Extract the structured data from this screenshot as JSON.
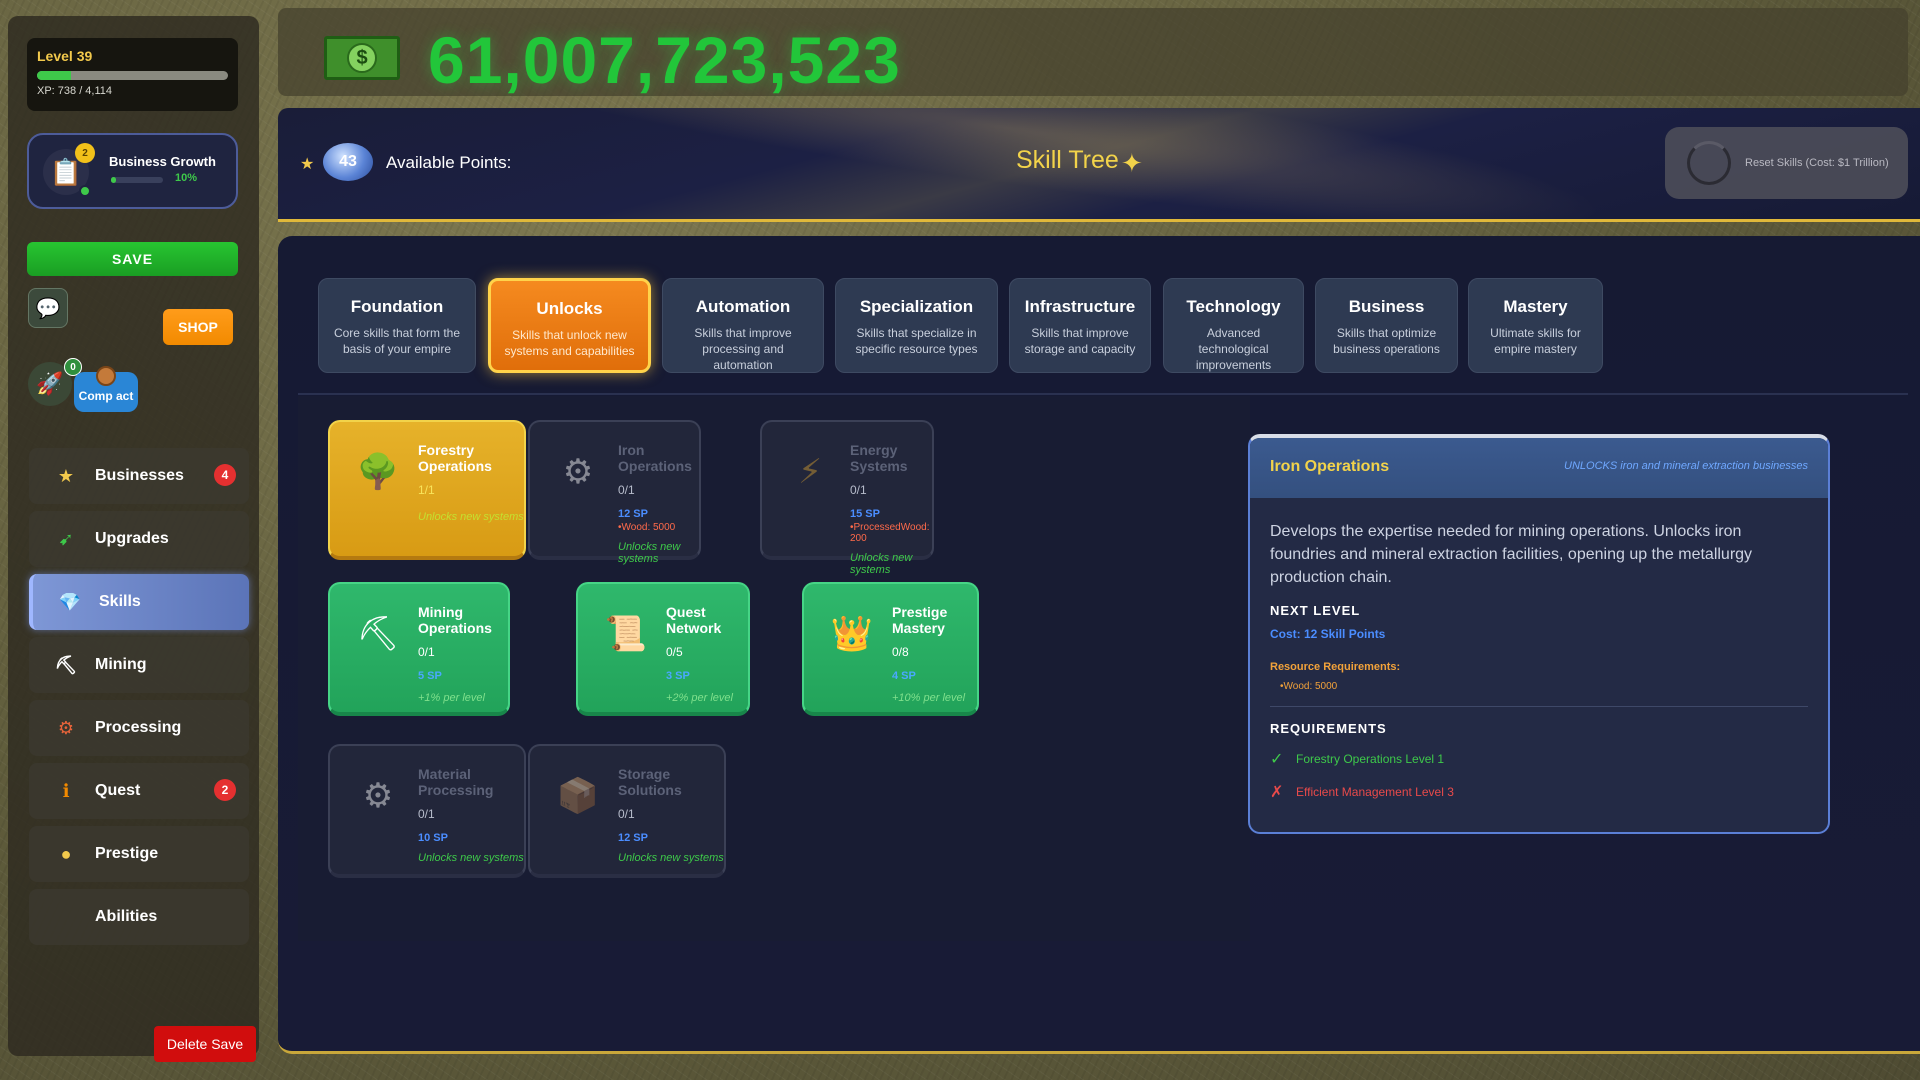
{
  "player": {
    "level_label": "Level 39",
    "xp_text": "XP: 738 / 4,114",
    "xp_fraction": 0.179
  },
  "growth": {
    "label": "Business Growth",
    "percent_text": "10%",
    "fraction": 0.1,
    "badge": "2"
  },
  "buttons": {
    "save": "SAVE",
    "shop": "SHOP",
    "compact": "Comp act",
    "rocket_badge": "0",
    "delete_save": "Delete Save"
  },
  "nav": {
    "items": [
      {
        "label": "Businesses",
        "icon": "star-icon",
        "glyph": "★",
        "badge": "4",
        "active": false
      },
      {
        "label": "Upgrades",
        "icon": "upgrade-arrow-icon",
        "glyph": "➹",
        "badge": "",
        "active": false
      },
      {
        "label": "Skills",
        "icon": "diamond-icon",
        "glyph": "💎",
        "badge": "",
        "active": true
      },
      {
        "label": "Mining",
        "icon": "mining-cart-icon",
        "glyph": "⛏",
        "badge": "",
        "active": false
      },
      {
        "label": "Processing",
        "icon": "gear-icon",
        "glyph": "⚙",
        "badge": "",
        "active": false
      },
      {
        "label": "Quest",
        "icon": "info-icon",
        "glyph": "ℹ",
        "badge": "2",
        "active": false
      },
      {
        "label": "Prestige",
        "icon": "coin-icon",
        "glyph": "●",
        "badge": "",
        "active": false
      },
      {
        "label": "Abilities",
        "icon": "",
        "glyph": "",
        "badge": "",
        "active": false
      }
    ]
  },
  "money": {
    "amount": "61,007,723,523",
    "icon": "dollar-bill-icon"
  },
  "skill_tree": {
    "available_points_value": "43",
    "available_points_label": "Available Points:",
    "title": "Skill Tree",
    "reset_label": "Reset Skills (Cost: $1 Trillion)"
  },
  "tabs": [
    {
      "title": "Foundation",
      "desc": "Core skills that form the basis of your empire",
      "active": false
    },
    {
      "title": "Unlocks",
      "desc": "Skills that unlock new systems and capabilities",
      "active": true
    },
    {
      "title": "Automation",
      "desc": "Skills that improve processing and automation",
      "active": false
    },
    {
      "title": "Specialization",
      "desc": "Skills that specialize in specific resource types",
      "active": false
    },
    {
      "title": "Infrastructure",
      "desc": "Skills that improve storage and capacity",
      "active": false
    },
    {
      "title": "Technology",
      "desc": "Advanced technological improvements",
      "active": false
    },
    {
      "title": "Business",
      "desc": "Skills that optimize business operations",
      "active": false
    },
    {
      "title": "Mastery",
      "desc": "Ultimate skills for empire mastery",
      "active": false
    }
  ],
  "skills": [
    {
      "name": "Forestry Operations",
      "level": "1/1",
      "sp": "",
      "req": "",
      "effect": "Unlocks new systems",
      "state": "gold",
      "icon": "tree-icon",
      "glyph": "🌳"
    },
    {
      "name": "Iron Operations",
      "level": "0/1",
      "sp": "12 SP",
      "req": "•Wood: 5000",
      "effect": "Unlocks new systems",
      "state": "locked",
      "icon": "iron-ore-icon",
      "glyph": "⚙"
    },
    {
      "name": "Energy Systems",
      "level": "0/1",
      "sp": "15 SP",
      "req": "•ProcessedWood: 200",
      "effect": "Unlocks new systems",
      "state": "locked",
      "icon": "lightning-icon",
      "glyph": "⚡"
    },
    {
      "name": "Mining Operations",
      "level": "0/1",
      "sp": "5 SP",
      "req": "",
      "effect": "+1% per level",
      "state": "green",
      "icon": "mining-cart-icon",
      "glyph": "⛏"
    },
    {
      "name": "Quest Network",
      "level": "0/5",
      "sp": "3 SP",
      "req": "",
      "effect": "+2% per level",
      "state": "green",
      "icon": "scroll-icon",
      "glyph": "📜"
    },
    {
      "name": "Prestige Mastery",
      "level": "0/8",
      "sp": "4 SP",
      "req": "",
      "effect": "+10% per level",
      "state": "green",
      "icon": "crown-emblem-icon",
      "glyph": "👑"
    },
    {
      "name": "Material Processing",
      "level": "0/1",
      "sp": "10 SP",
      "req": "",
      "effect": "Unlocks new systems",
      "state": "locked",
      "icon": "processing-icon",
      "glyph": "⚙"
    },
    {
      "name": "Storage Solutions",
      "level": "0/1",
      "sp": "12 SP",
      "req": "",
      "effect": "Unlocks new systems",
      "state": "locked",
      "icon": "storage-crate-icon",
      "glyph": "📦"
    }
  ],
  "detail": {
    "title": "Iron Operations",
    "tag": "UNLOCKS iron and mineral extraction businesses",
    "description": "Develops the expertise needed for mining operations. Unlocks iron foundries and mineral extraction facilities, opening up the metallurgy production chain.",
    "next_level_label": "NEXT LEVEL",
    "cost": "Cost: 12 Skill Points",
    "resource_label": "Resource Requirements:",
    "resource_item": "•Wood: 5000",
    "requirements_label": "REQUIREMENTS",
    "requirements": [
      {
        "text": "Forestry Operations Level 1",
        "met": true,
        "mark": "✓"
      },
      {
        "text": "Efficient Management Level 3",
        "met": false,
        "mark": "✗"
      }
    ]
  },
  "colors": {
    "money_green": "#22c63a",
    "gold": "#f2d34a",
    "active_tab": "#f58a1f",
    "unlocked_card": "#2fb86c",
    "badge_red": "#e53030"
  }
}
